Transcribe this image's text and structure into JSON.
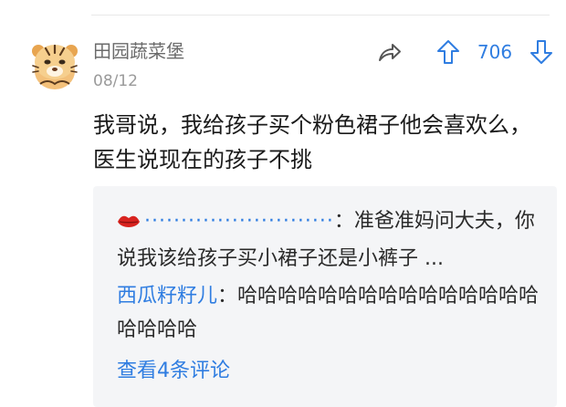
{
  "post": {
    "username": "田园蔬菜堡",
    "date": "08/12",
    "vote_count": "706",
    "text": "我哥说，我给孩子买个粉色裙子他会喜欢么，医生说现在的孩子不挑"
  },
  "replies": {
    "items": [
      {
        "author": "··························",
        "separator": "：",
        "text": "准爸准妈问大夫，你说我该给孩子买小裙子还是小裤子 ..."
      },
      {
        "author": "西瓜籽籽儿",
        "separator": "：",
        "text": "哈哈哈哈哈哈哈哈哈哈哈哈哈哈哈哈哈哈哈"
      }
    ],
    "view_more": "查看4条评论"
  },
  "icons": {
    "avatar": "tiger-avatar",
    "share": "share-arrow-icon",
    "upvote": "arrow-up-icon",
    "downvote": "arrow-down-icon",
    "lips": "lips-icon"
  },
  "colors": {
    "accent": "#2f7de1",
    "reply_bg": "#f4f5f7",
    "username": "#6b6b6b",
    "date": "#9a9a9a"
  }
}
